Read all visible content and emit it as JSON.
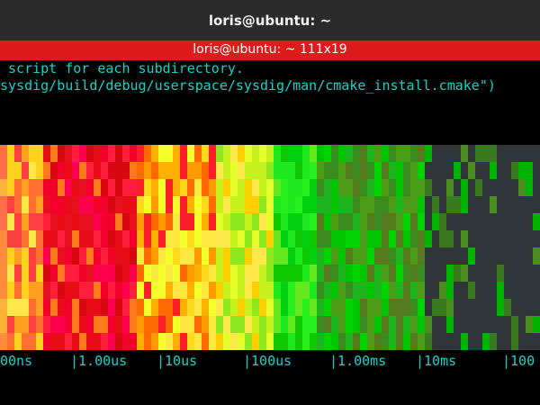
{
  "window": {
    "title": "loris@ubuntu: ~"
  },
  "tmux": {
    "pane_title": "loris@ubuntu: ~ 111x19"
  },
  "terminal": {
    "lines": [
      " script for each subdirectory.",
      "sysdig/build/debug/userspace/sysdig/man/cmake_install.cmake\")"
    ]
  },
  "axis": {
    "ticks": [
      "00ns",
      "|1.00us",
      "|10us",
      "|100us",
      "|1.00ms",
      "|10ms",
      "|100"
    ]
  },
  "colors": {
    "terminal_text": "#0bd5c9",
    "tmux_bar": "#de1b1b",
    "titlebar": "#2b2b2b",
    "heatmap_empty": "#303539"
  },
  "chart_data": {
    "type": "heatmap",
    "x_scale": "log",
    "xlabel": "",
    "ylabel": "",
    "x_ticks": [
      "00ns",
      "|1.00us",
      "|10us",
      "|100us",
      "|1.00ms",
      "|10ms",
      "|100"
    ],
    "color_scale": "red (high count) → orange → yellow → green → dark green (low count) → grey (no data)"
  }
}
